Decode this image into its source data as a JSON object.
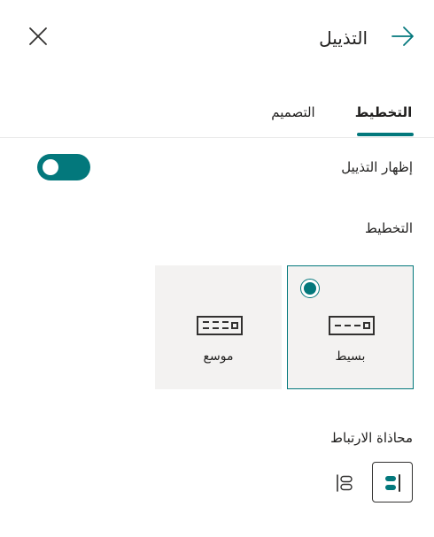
{
  "header": {
    "title": "التذييل",
    "back_icon": "arrow-right-icon",
    "close_icon": "close-icon"
  },
  "tabs": [
    {
      "label": "التخطيط",
      "selected": true
    },
    {
      "label": "التصميم",
      "selected": false
    }
  ],
  "show_footer": {
    "label": "إظهار التذييل",
    "enabled": true
  },
  "layout": {
    "label": "التخطيط",
    "options": [
      {
        "label": "بسيط",
        "selected": true,
        "icon": "layout-simple-icon"
      },
      {
        "label": "موسع",
        "selected": false,
        "icon": "layout-extended-icon"
      }
    ]
  },
  "link_alignment": {
    "label": "محاذاة الارتباط",
    "options": [
      {
        "icon": "align-right-icon",
        "selected": true
      },
      {
        "icon": "align-left-icon",
        "selected": false
      }
    ]
  },
  "colors": {
    "accent": "#03787c",
    "card_background": "#f3f2f1",
    "text": "#201f1e"
  }
}
